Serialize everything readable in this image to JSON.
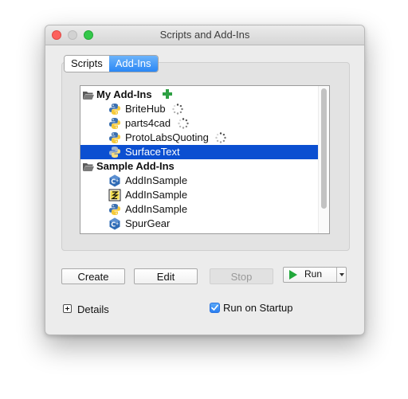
{
  "window": {
    "title": "Scripts and Add-Ins"
  },
  "tabs": [
    {
      "label": "Scripts",
      "active": false
    },
    {
      "label": "Add-Ins",
      "active": true
    }
  ],
  "tree": {
    "groups": [
      {
        "label": "My Add-Ins",
        "items": [
          {
            "label": "BriteHub",
            "icon": "python-icon",
            "loading": true,
            "selected": false
          },
          {
            "label": "parts4cad",
            "icon": "python-icon",
            "loading": true,
            "selected": false
          },
          {
            "label": "ProtoLabsQuoting",
            "icon": "python-icon",
            "loading": true,
            "selected": false
          },
          {
            "label": "SurfaceText",
            "icon": "python-icon",
            "loading": false,
            "selected": true
          }
        ]
      },
      {
        "label": "Sample Add-Ins",
        "items": [
          {
            "label": "AddInSample",
            "icon": "cpp-icon"
          },
          {
            "label": "AddInSample",
            "icon": "javascript-icon"
          },
          {
            "label": "AddInSample",
            "icon": "python-icon"
          },
          {
            "label": "SpurGear",
            "icon": "cpp-icon"
          }
        ]
      }
    ]
  },
  "buttons": {
    "create": "Create",
    "edit": "Edit",
    "stop": "Stop",
    "run": "Run"
  },
  "footer": {
    "details_label": "Details",
    "run_on_startup_label": "Run on Startup",
    "run_on_startup_checked": true
  },
  "colors": {
    "selection": "#0b4fd1",
    "tab_active": "#2a87f5",
    "run_play": "#21a83b",
    "add_plus": "#2ea043"
  }
}
